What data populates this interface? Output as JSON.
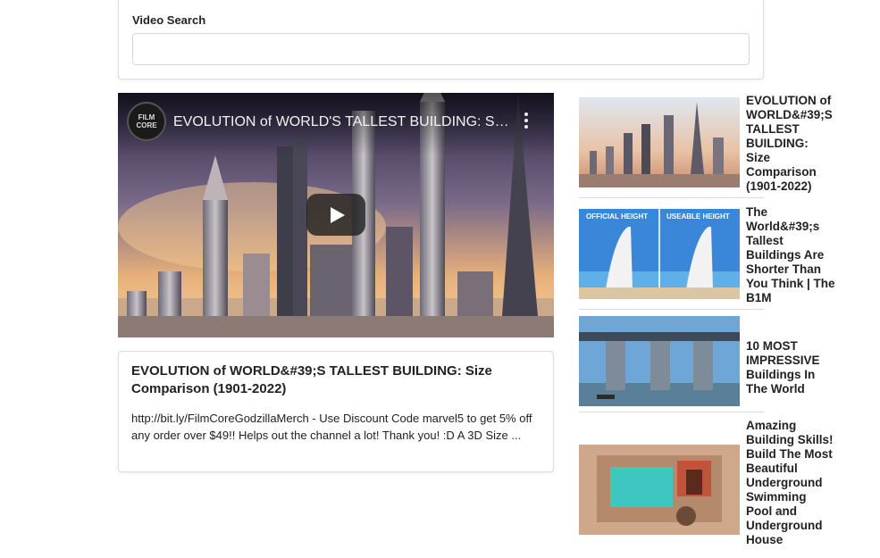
{
  "search": {
    "label": "Video Search",
    "value": "",
    "placeholder": ""
  },
  "player": {
    "title": "EVOLUTION of WORLD'S TALLEST BUILDING: Size Comparison (1901-2022)",
    "channel_logo_text": "FILM CORE"
  },
  "selected_video": {
    "title": "EVOLUTION of WORLD&#39;S TALLEST BUILDING: Size Comparison (1901-2022)",
    "description": "http://bit.ly/FilmCoreGodzillaMerch - Use Discount Code marvel5 to get 5% off any order over $49!! Helps out the channel a lot! Thank you! :D A 3D Size ..."
  },
  "video_list": [
    {
      "title": "EVOLUTION of WORLD&#39;S TALLEST BUILDING: Size Comparison (1901-2022)"
    },
    {
      "title": "The World&#39;s Tallest Buildings Are Shorter Than You Think | The B1M",
      "overlay_left": "OFFICIAL HEIGHT",
      "overlay_right": "USEABLE HEIGHT"
    },
    {
      "title": "10 MOST IMPRESSIVE Buildings In The World"
    },
    {
      "title": "Amazing Building Skills! Build The Most Beautiful Underground Swimming Pool and Underground House"
    }
  ]
}
